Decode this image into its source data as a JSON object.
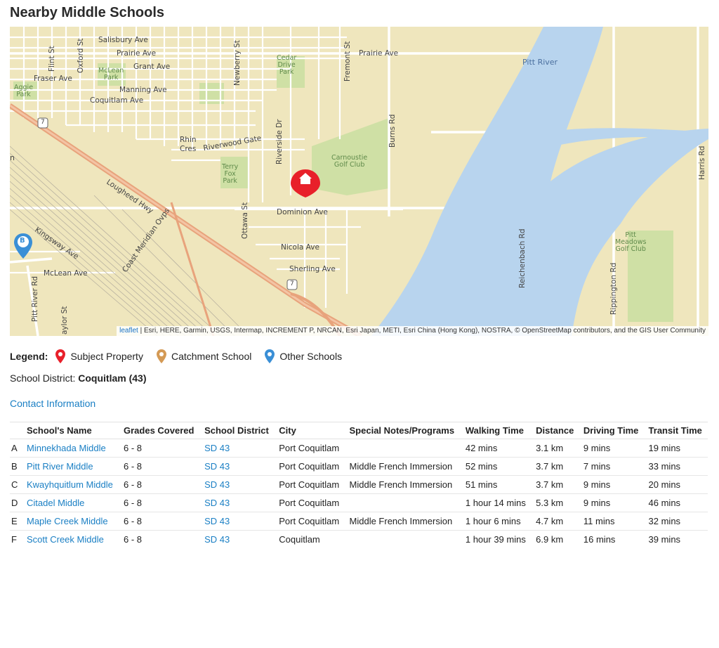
{
  "page": {
    "title": "Nearby Middle Schools"
  },
  "map": {
    "labels": {
      "salisbury": "Salisbury Ave",
      "prairie_w": "Prairie Ave",
      "prairie_e": "Prairie Ave",
      "grant": "Grant Ave",
      "fraser": "Fraser Ave",
      "manning": "Manning Ave",
      "coquitlam": "Coquitlam Ave",
      "mclean_park": "McLean\nPark",
      "aggie_park": "Aggie\nPark",
      "cedar_park": "Cedar\nDrive\nPark",
      "pitt_river": "Pitt River",
      "carnoustie": "Carnoustie\nGolf Club",
      "rhin": "Rhin",
      "cres": "Cres",
      "riverwood": "Riverwood Gate",
      "terry_fox": "Terry\nFox\nPark",
      "lougheed": "Lougheed Hwy",
      "dominion": "Dominion Ave",
      "nicola": "Nicola Ave",
      "sherling": "Sherling Ave",
      "mclean_ave": "McLean Ave",
      "kingsway": "Kingsway Ave",
      "coast_meridian": "Coast Meridian Ovps",
      "pitt_meadows": "Pitt\nMeadows\nGolf Club",
      "flint": "Flint St",
      "oxford": "Oxford St",
      "newberry": "Newberry St",
      "fremont": "Fremont St",
      "burns": "Burns Rd",
      "riverside": "Riverside Dr",
      "ottawa": "Ottawa St",
      "reichenbach": "Reichenbach Rd",
      "rippington": "Rippington Rd",
      "harris": "Harris Rd",
      "pitt_river_rd": "Pitt River Rd",
      "taylor": "aylor St",
      "hwy7a": "7",
      "hwy7b": "7",
      "edge_n": "n",
      "marker_b": "B"
    },
    "attribution_link": "leaflet",
    "attribution_text": " | Esri, HERE, Garmin, USGS, Intermap, INCREMENT P, NRCAN, Esri Japan, METI, Esri China (Hong Kong), NOSTRA, © OpenStreetMap contributors, and the GIS User Community",
    "colors": {
      "land": "#efe6bd",
      "water": "#b8d4ee",
      "park": "#cfe0a5",
      "road": "#ffffff",
      "highway": "#e8a37c",
      "subject_marker": "#e8202a",
      "catchment_marker": "#d49a55",
      "other_marker": "#3a8fd6"
    }
  },
  "legend": {
    "label": "Legend:",
    "subject": "Subject Property",
    "catchment": "Catchment School",
    "other": "Other Schools"
  },
  "district": {
    "label": "School District:",
    "value": "Coquitlam (43)"
  },
  "contact": {
    "label": "Contact Information"
  },
  "table": {
    "headers": [
      "",
      "School's Name",
      "Grades Covered",
      "School District",
      "City",
      "Special Notes/Programs",
      "Walking Time",
      "Distance",
      "Driving Time",
      "Transit Time"
    ],
    "rows": [
      [
        "A",
        "Minnekhada Middle",
        "6 - 8",
        "SD 43",
        "Port Coquitlam",
        "",
        "42 mins",
        "3.1 km",
        "9 mins",
        "19 mins"
      ],
      [
        "B",
        "Pitt River Middle",
        "6 - 8",
        "SD 43",
        "Port Coquitlam",
        "Middle French Immersion",
        "52 mins",
        "3.7 km",
        "7 mins",
        "33 mins"
      ],
      [
        "C",
        "Kwayhquitlum Middle",
        "6 - 8",
        "SD 43",
        "Port Coquitlam",
        "Middle French Immersion",
        "51 mins",
        "3.7 km",
        "9 mins",
        "20 mins"
      ],
      [
        "D",
        "Citadel Middle",
        "6 - 8",
        "SD 43",
        "Port Coquitlam",
        "",
        "1 hour 14 mins",
        "5.3 km",
        "9 mins",
        "46 mins"
      ],
      [
        "E",
        "Maple Creek Middle",
        "6 - 8",
        "SD 43",
        "Port Coquitlam",
        "Middle French Immersion",
        "1 hour 6 mins",
        "4.7 km",
        "11 mins",
        "32 mins"
      ],
      [
        "F",
        "Scott Creek Middle",
        "6 - 8",
        "SD 43",
        "Coquitlam",
        "",
        "1 hour 39 mins",
        "6.9 km",
        "16 mins",
        "39 mins"
      ]
    ]
  }
}
